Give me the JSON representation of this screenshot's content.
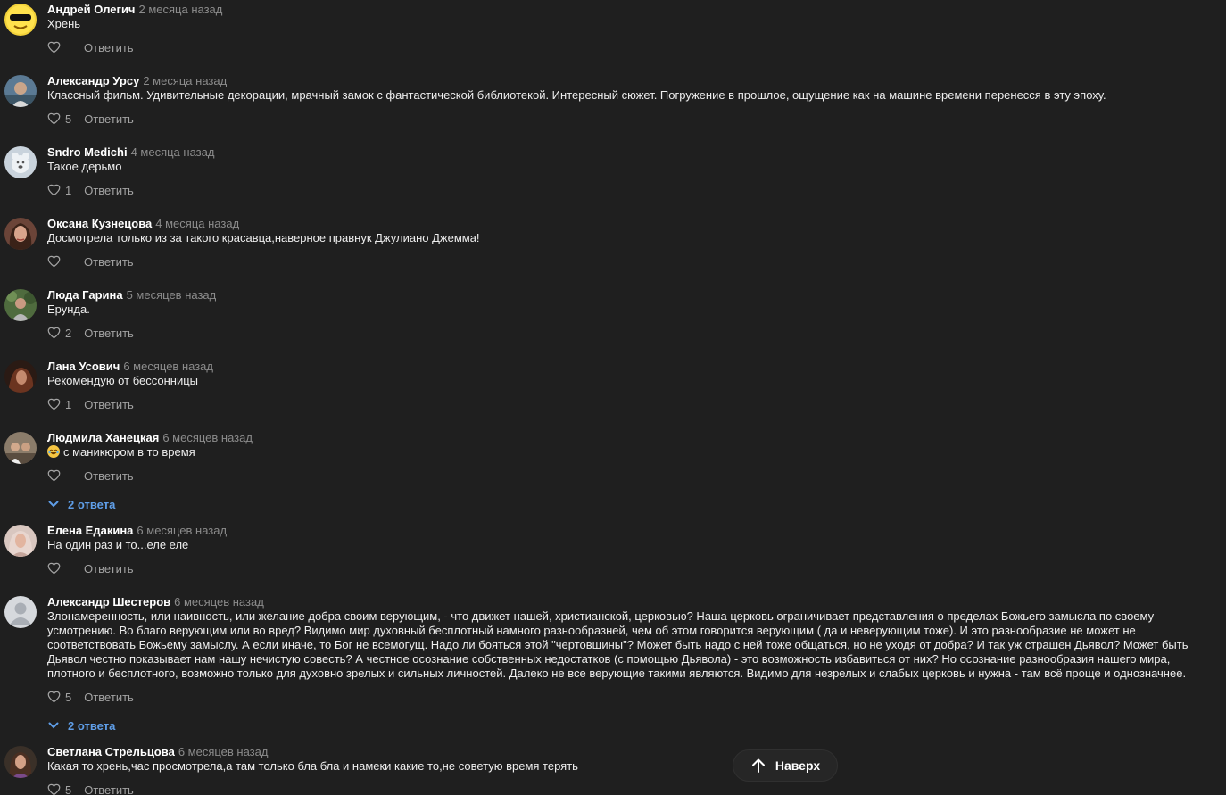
{
  "comments": [
    {
      "author": "Андрей Олегич",
      "time": "2 месяца назад",
      "text": "Хрень",
      "likes": "",
      "reply": "Ответить"
    },
    {
      "author": "Александр Урсу",
      "time": "2 месяца назад",
      "text": "Классный фильм. Удивительные декорации, мрачный замок с фантастической библиотекой. Интересный сюжет. Погружение в прошлое, ощущение как на машине времени перенесся в эту эпоху.",
      "likes": "5",
      "reply": "Ответить"
    },
    {
      "author": "Sndro Medichi",
      "time": "4 месяца назад",
      "text": "Такое дерьмо",
      "likes": "1",
      "reply": "Ответить"
    },
    {
      "author": "Оксана Кузнецова",
      "time": "4 месяца назад",
      "text": "Досмотрела только из за такого красавца,наверное правнук Джулиано Джемма!",
      "likes": "",
      "reply": "Ответить"
    },
    {
      "author": "Люда Гарина",
      "time": "5 месяцев назад",
      "text": "Ерунда.",
      "likes": "2",
      "reply": "Ответить"
    },
    {
      "author": "Лана Усович",
      "time": "6 месяцев назад",
      "text": "Рекомендую от бессонницы",
      "likes": "1",
      "reply": "Ответить"
    },
    {
      "author": "Людмила Ханецкая",
      "time": "6 месяцев назад",
      "text": "с маникюром в то время",
      "likes": "",
      "reply": "Ответить",
      "replies": "2 ответа"
    },
    {
      "author": "Елена Едакина",
      "time": "6 месяцев назад",
      "text": "На один раз и то...еле еле",
      "likes": "",
      "reply": "Ответить"
    },
    {
      "author": "Александр Шестеров",
      "time": "6 месяцев назад",
      "text": "Злонамеренность, или наивность, или желание добра своим верующим, - что движет нашей, христианской, церковью? Наша церковь ограничивает представления о пределах Божьего замысла по своему усмотрению. Во благо верующим или во вред? Видимо мир духовный бесплотный намного разнообразней, чем об этом говорится верующим ( да и неверующим тоже). И это разнообразие не может не соответствовать Божьему замыслу. А если иначе, то Бог не всемогущ. Надо ли бояться этой \"чертовщины\"? Может быть надо с ней тоже общаться, но не уходя от добра? И так уж страшен Дьявол? Может быть Дьявол честно показывает нам нашу нечистую совесть? А честное осознание собственных недостатков (с помощью Дьявола) - это возможность избавиться от них? Но осознание разнообразия нашего мира, плотного и бесплотного, возможно только для духовно зрелых и сильных личностей. Далеко не все верующие такими являются. Видимо для незрелых и слабых церковь и нужна - там всё проще и однозначнее.",
      "likes": "5",
      "reply": "Ответить",
      "replies": "2 ответа"
    },
    {
      "author": "Светлана Стрельцова",
      "time": "6 месяцев назад",
      "text": "Какая то хрень,час просмотрела,а там только бла бла и намеки какие то,не советую время терять",
      "likes": "5",
      "reply": "Ответить"
    }
  ],
  "scroll_top": {
    "label": "Наверх"
  },
  "colors": {
    "background": "#1f1f1f",
    "link": "#5f9ee8",
    "muted": "#8c8c8c"
  }
}
